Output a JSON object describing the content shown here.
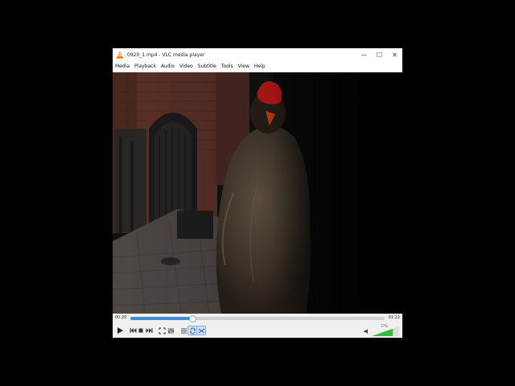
{
  "window": {
    "title": "0920_1.mp4 - VLC media player",
    "minimize_glyph": "—",
    "maximize_glyph": "☐",
    "close_glyph": "✕"
  },
  "menu": {
    "items": [
      {
        "label": "Media"
      },
      {
        "label": "Playback"
      },
      {
        "label": "Audio"
      },
      {
        "label": "Video"
      },
      {
        "label": "Subtitle"
      },
      {
        "label": "Tools"
      },
      {
        "label": "View"
      },
      {
        "label": "Help"
      }
    ]
  },
  "player": {
    "elapsed": "00:20",
    "total": "01:22",
    "progress_percent": 24.4,
    "volume_label": "77%",
    "volume_percent": 77,
    "accent_color": "#3a8fd8",
    "volume_color": "#2fbf3a"
  },
  "controls": {
    "icons": [
      "play-icon",
      "previous-icon",
      "stop-icon",
      "next-icon",
      "fullscreen-icon",
      "extended-settings-icon",
      "playlist-icon",
      "loop-icon",
      "random-icon",
      "speaker-icon"
    ]
  }
}
